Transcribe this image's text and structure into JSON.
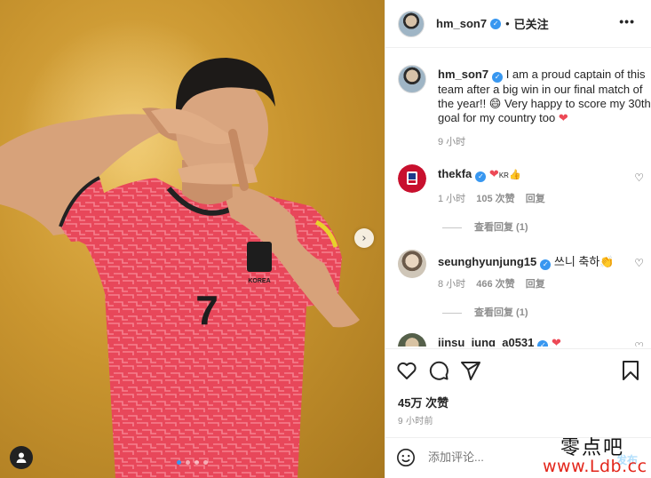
{
  "post": {
    "username": "hm_son7",
    "separator": "•",
    "follow_status": "已关注",
    "more": "•••",
    "caption": {
      "username": "hm_son7",
      "text": "I am a proud captain of this team after a big win in our final match of the year!! 😄 Very happy to score my 30th goal for my country too",
      "time": "9 小时"
    },
    "jersey": {
      "number": "7",
      "crest_text": "KOREA"
    }
  },
  "comments": [
    {
      "username": "thekfa",
      "text": "KR",
      "time": "1 小时",
      "likes": "105 次赞",
      "reply": "回复",
      "view_replies": "查看回复 (1)"
    },
    {
      "username": "seunghyunjung15",
      "text": "쓰니 축하",
      "time": "8 小时",
      "likes": "466 次赞",
      "reply": "回复",
      "view_replies": "查看回复 (1)"
    },
    {
      "username": "jinsu_jung_a0531",
      "text": ""
    }
  ],
  "actions": {
    "likes": "45万 次赞",
    "time_ago": "9 小时前"
  },
  "composer": {
    "placeholder": "添加评论...",
    "post_label": "发布"
  },
  "watermark": {
    "line1": "零点吧",
    "line2": "www.Ldb.cc"
  },
  "carousel": {
    "pages": 4,
    "current": 1
  },
  "icons": [
    "next-arrow-icon",
    "user-tag-icon",
    "verified-icon",
    "more-icon",
    "heart-icon",
    "comment-icon",
    "share-icon",
    "bookmark-icon",
    "emoji-icon"
  ],
  "colors": {
    "link_blue": "#3897f0",
    "heart_red": "#ed4956",
    "jersey_red": "#e8475a",
    "background_gold": "#c9952f"
  }
}
